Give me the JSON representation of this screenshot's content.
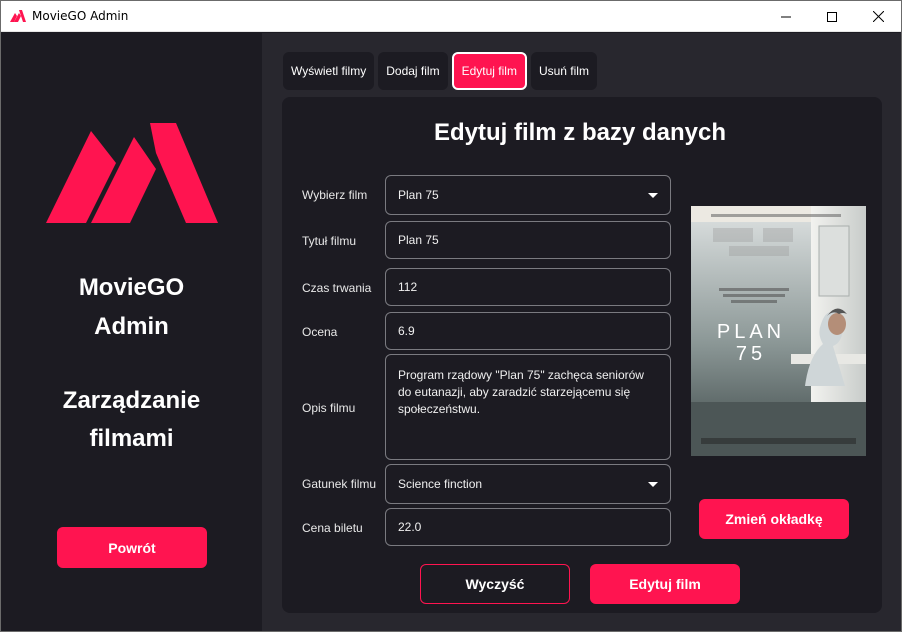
{
  "window": {
    "title": "MovieGO Admin",
    "accent": "#ff1450"
  },
  "titlebar_icons": [
    "app-logo-icon",
    "minimize-icon",
    "maximize-icon",
    "close-icon"
  ],
  "sidebar": {
    "title_line1": "MovieGO",
    "title_line2": "Admin",
    "subtitle_line1": "Zarządzanie",
    "subtitle_line2": "filmami",
    "back_label": "Powrót"
  },
  "tabs": [
    {
      "label": "Wyświetl filmy",
      "active": false
    },
    {
      "label": "Dodaj film",
      "active": false
    },
    {
      "label": "Edytuj film",
      "active": true
    },
    {
      "label": "Usuń film",
      "active": false
    }
  ],
  "form": {
    "heading": "Edytuj film z bazy danych",
    "select_movie": {
      "label": "Wybierz film",
      "value": "Plan 75"
    },
    "title": {
      "label": "Tytuł filmu",
      "value": "Plan 75"
    },
    "duration": {
      "label": "Czas trwania",
      "value": "112"
    },
    "rating": {
      "label": "Ocena",
      "value": "6.9"
    },
    "description": {
      "label": "Opis filmu",
      "value": "Program rządowy \"Plan 75\" zachęca seniorów do eutanazji, aby zaradzić starzejącemu się społeczeństwu."
    },
    "genre": {
      "label": "Gatunek filmu",
      "value": "Science finction"
    },
    "price": {
      "label": "Cena biletu",
      "value": "22.0"
    }
  },
  "poster": {
    "title_line1": "PLAN",
    "title_line2": "75"
  },
  "buttons": {
    "change_cover": "Zmień okładkę",
    "clear": "Wyczyść",
    "edit": "Edytuj film"
  }
}
